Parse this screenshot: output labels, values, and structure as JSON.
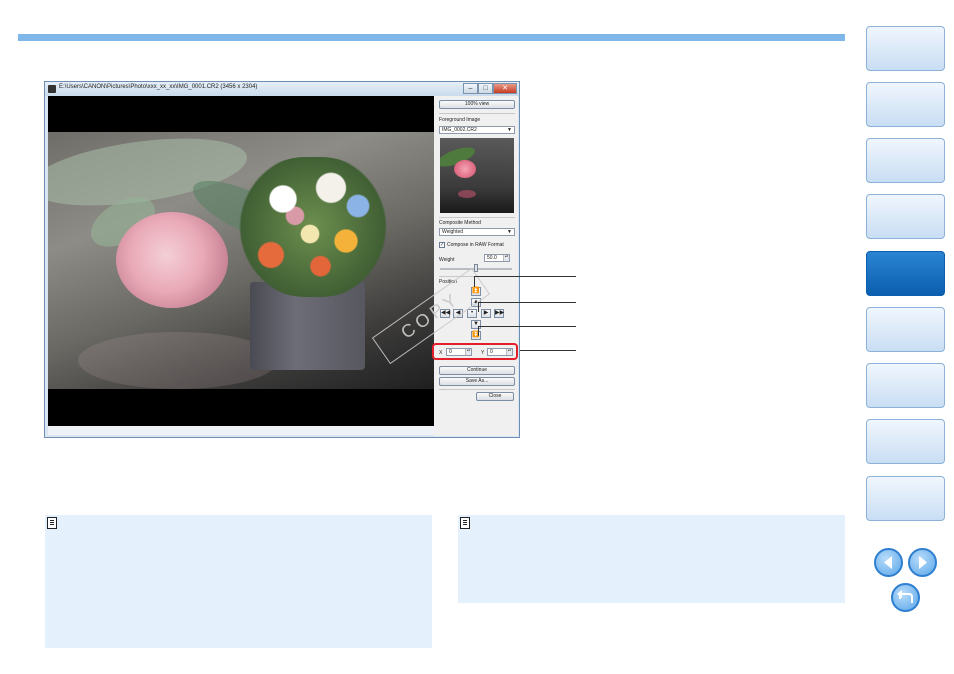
{
  "window": {
    "title": "E:\\Users\\CANON\\Pictures\\Photo\\xxx_xx_xx\\IMG_0001.CR2 (3456 x 2304)",
    "minimize_glyph": "–",
    "maximize_glyph": "□",
    "close_glyph": "✕"
  },
  "panel": {
    "view_100_label": "100% view",
    "foreground_label": "Foreground Image",
    "foreground_value": "IMG_0002.CR2",
    "composite_label": "Composite Method",
    "composite_value": "Weighted",
    "raw_checkbox_label": "Compose in RAW Format",
    "raw_checked": true,
    "weight_label": "Weight",
    "weight_value": "50.0",
    "weight_fraction": 0.5,
    "position_label": "Position",
    "x_label": "X",
    "x_value": "0",
    "y_label": "Y",
    "y_value": "0",
    "continue_label": "Continue",
    "save_as_label": "Save As...",
    "close_label": "Close"
  },
  "position_buttons": {
    "top_top": "⏫",
    "up": "▲",
    "left_left": "◀◀",
    "left": "◀",
    "center": "•",
    "right": "▶",
    "right_right": "▶▶",
    "down": "▼",
    "bottom_bottom": "⏬"
  },
  "watermark": "COPY",
  "colors": {
    "accent": "#0b5fae",
    "highlight": "#e3202a",
    "note_bg": "#e4f0fc",
    "top_bar": "#7fb7ea"
  },
  "sidebar_tabs": 9,
  "active_tab_index": 4
}
